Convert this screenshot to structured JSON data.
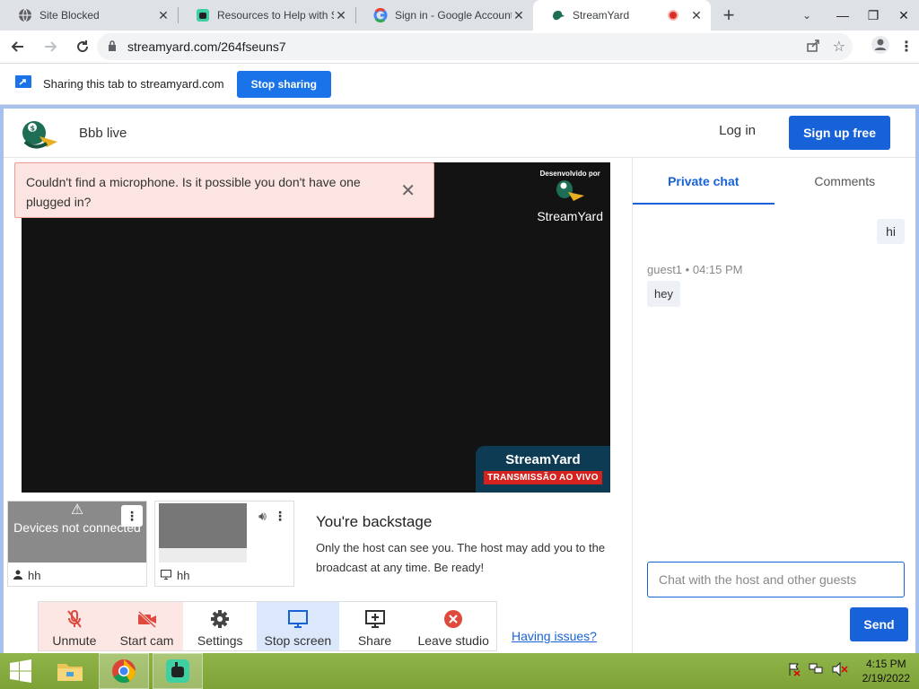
{
  "browser": {
    "tabs": [
      {
        "title": "Site Blocked"
      },
      {
        "title": "Resources to Help with St"
      },
      {
        "title": "Sign in - Google Account"
      },
      {
        "title": "StreamYard"
      }
    ],
    "url": "streamyard.com/264fseuns7",
    "sharing_text": "Sharing this tab to streamyard.com",
    "stop_sharing": "Stop sharing"
  },
  "header": {
    "title": "Bbb live",
    "login": "Log in",
    "signup": "Sign up free"
  },
  "stage": {
    "watermark_small": "Desenvolvido por",
    "watermark_brand": "StreamYard",
    "live_name": "StreamYard",
    "live_badge": "TRANSMISSÃO AO VIVO"
  },
  "alert": {
    "message": "Couldn't find a microphone. Is it possible you don't have one plugged in?"
  },
  "thumbs": [
    {
      "status": "Devices not connected",
      "name": "hh"
    },
    {
      "name": "hh"
    }
  ],
  "backstage": {
    "title": "You're backstage",
    "text": "Only the host can see you. The host may add you to the broadcast at any time. Be ready!"
  },
  "controls": {
    "unmute": "Unmute",
    "start_cam": "Start cam",
    "settings": "Settings",
    "stop_screen": "Stop screen",
    "share": "Share",
    "leave": "Leave studio",
    "having_issues": "Having issues?"
  },
  "chat": {
    "tab_private": "Private chat",
    "tab_comments": "Comments",
    "my_message": "hi",
    "guest_name": "guest1",
    "guest_time": "04:15 PM",
    "guest_message": "hey",
    "input_placeholder": "Chat with the host and other guests",
    "send": "Send"
  },
  "taskbar": {
    "time": "4:15 PM",
    "date": "2/19/2022"
  }
}
